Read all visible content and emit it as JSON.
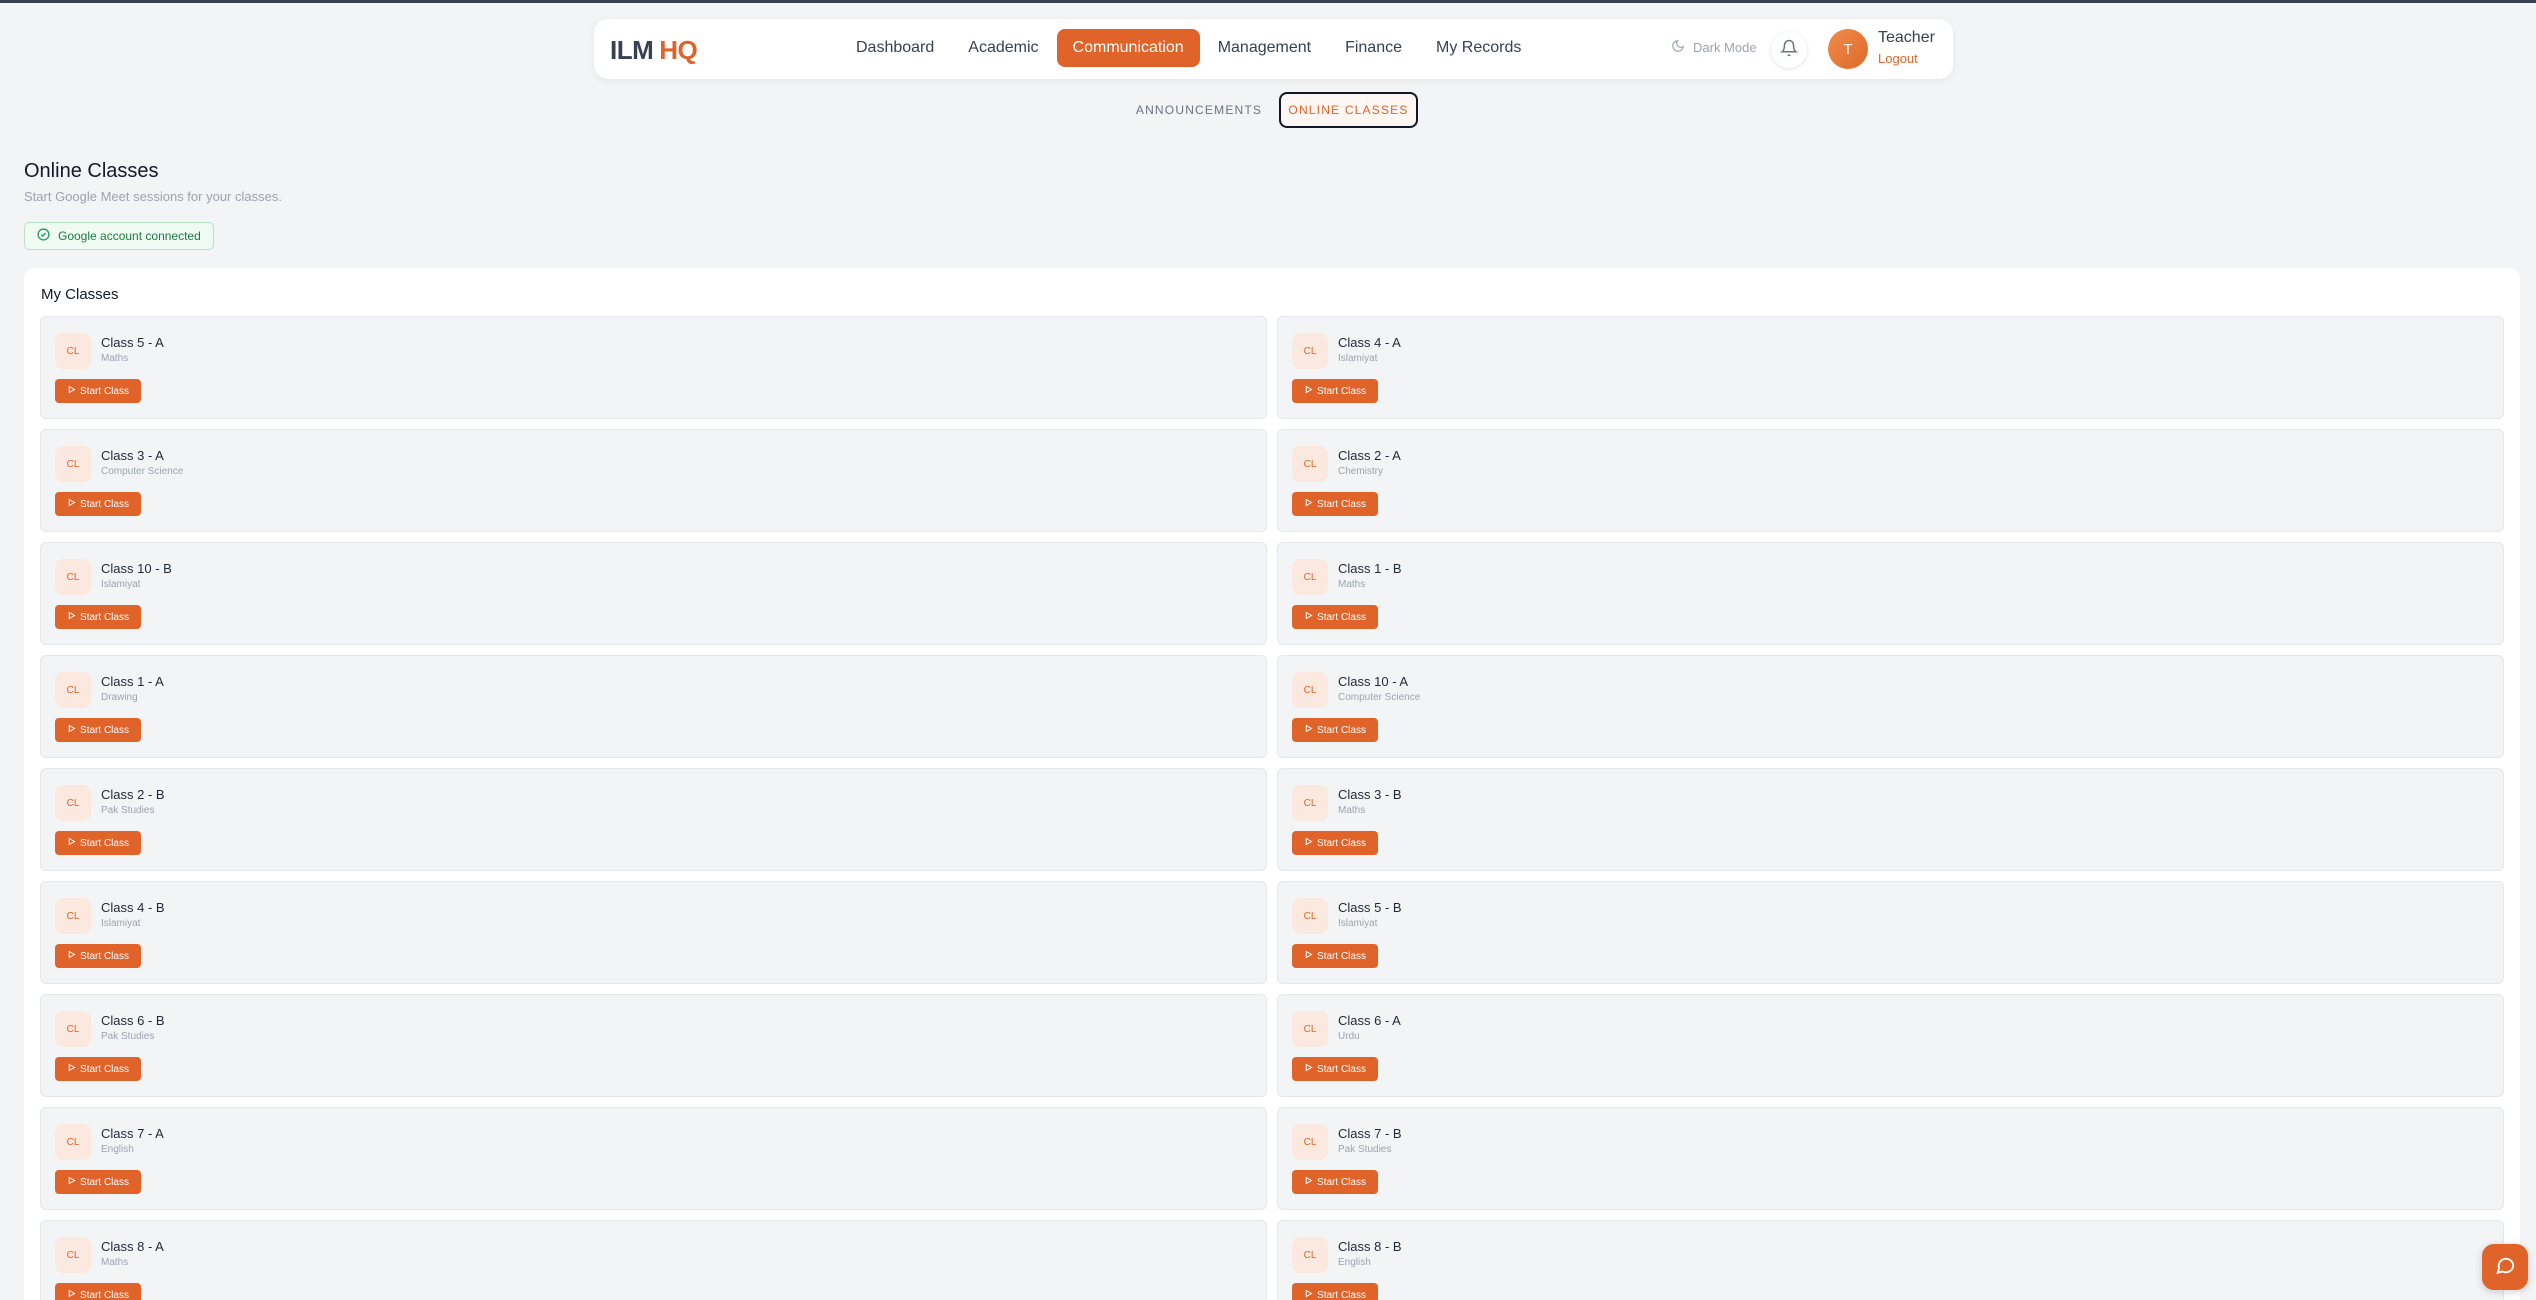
{
  "app": {
    "logo_part1": "ILM",
    "logo_part2": "HQ",
    "brand_color": "#e0632a"
  },
  "nav": {
    "links": [
      {
        "label": "Dashboard",
        "active": false
      },
      {
        "label": "Academic",
        "active": false
      },
      {
        "label": "Communication",
        "active": true
      },
      {
        "label": "Management",
        "active": false
      },
      {
        "label": "Finance",
        "active": false
      },
      {
        "label": "My Records",
        "active": false
      }
    ],
    "dark_mode_label": "Dark Mode",
    "bell_icon": "bell-icon",
    "user": {
      "avatar_initial": "T",
      "name": "Teacher",
      "logout_label": "Logout"
    }
  },
  "subtabs": [
    {
      "label": "Announcements",
      "active": false
    },
    {
      "label": "Online Classes",
      "active": true
    }
  ],
  "header": {
    "title": "Online Classes",
    "subtitle": "Start Google Meet sessions for your classes.",
    "google_status": "Google account connected"
  },
  "classes_panel": {
    "title": "My Classes",
    "badge_text": "CL",
    "button_label": "Start Class",
    "items": [
      {
        "name": "Class 5 - A",
        "subject": "Maths"
      },
      {
        "name": "Class 4 - A",
        "subject": "Islamiyat"
      },
      {
        "name": "Class 3 - A",
        "subject": "Computer Science"
      },
      {
        "name": "Class 2 - A",
        "subject": "Chemistry"
      },
      {
        "name": "Class 10 - B",
        "subject": "Islamiyat"
      },
      {
        "name": "Class 1 - B",
        "subject": "Maths"
      },
      {
        "name": "Class 1 - A",
        "subject": "Drawing"
      },
      {
        "name": "Class 10 - A",
        "subject": "Computer Science"
      },
      {
        "name": "Class 2 - B",
        "subject": "Pak Studies"
      },
      {
        "name": "Class 3 - B",
        "subject": "Maths"
      },
      {
        "name": "Class 4 - B",
        "subject": "Islamiyat"
      },
      {
        "name": "Class 5 - B",
        "subject": "Islamiyat"
      },
      {
        "name": "Class 6 - B",
        "subject": "Pak Studies"
      },
      {
        "name": "Class 6 - A",
        "subject": "Urdu"
      },
      {
        "name": "Class 7 - A",
        "subject": "English"
      },
      {
        "name": "Class 7 - B",
        "subject": "Pak Studies"
      },
      {
        "name": "Class 8 - A",
        "subject": "Maths"
      },
      {
        "name": "Class 8 - B",
        "subject": "English"
      }
    ]
  }
}
